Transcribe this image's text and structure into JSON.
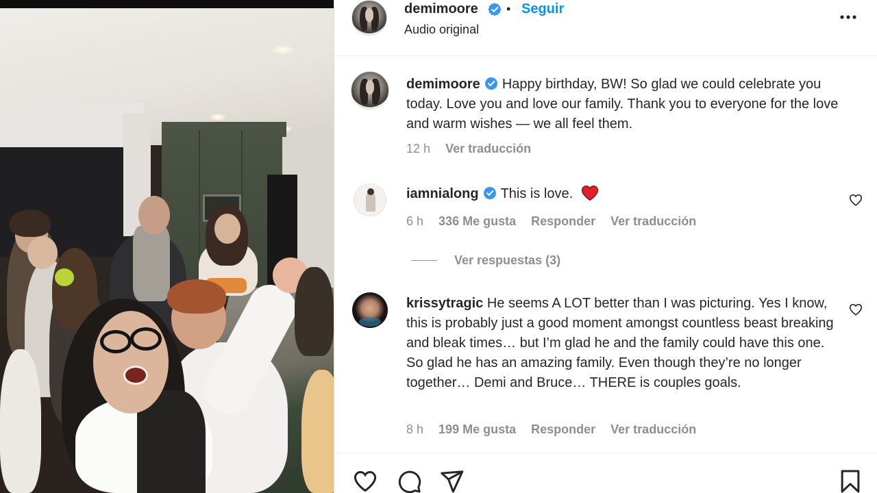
{
  "post": {
    "author": "demimoore",
    "verified": true,
    "follow_label": "Seguir",
    "separator": "•",
    "audio_label": "Audio original"
  },
  "caption": {
    "username": "demimoore",
    "text": "Happy birthday, BW! So glad we could celebrate you today. Love you and love our family. Thank you to everyone for the love and warm wishes — we all feel them.",
    "time": "12 h",
    "translate_label": "Ver traducción"
  },
  "comments": [
    {
      "username": "iamnialong",
      "verified": true,
      "text": "This is love.",
      "emoji": "heart",
      "time": "6 h",
      "likes_label": "336 Me gusta",
      "reply_label": "Responder",
      "translate_label": "Ver traducción",
      "view_replies_label": "Ver respuestas (3)"
    },
    {
      "username": "krissytragic",
      "verified": false,
      "text": "He seems A LOT better than I was picturing. Yes I know, this is probably just a good moment amongst countless beast breaking and bleak times… but I’m glad he and the family could have this one. So glad he has an amazing family. Even though they’re no longer together… Demi and Bruce… THERE is couples goals.",
      "time": "8 h",
      "likes_label": "199 Me gusta",
      "reply_label": "Responder",
      "translate_label": "Ver traducción"
    }
  ],
  "actions": {
    "icons": [
      "heart-icon",
      "comment-icon",
      "share-icon",
      "bookmark-icon"
    ]
  },
  "colors": {
    "link_blue": "#0095f6",
    "verified_blue": "#3897f0",
    "muted_gray": "#8e8e8e",
    "text": "#262626",
    "heart_red": "#e0202c"
  }
}
